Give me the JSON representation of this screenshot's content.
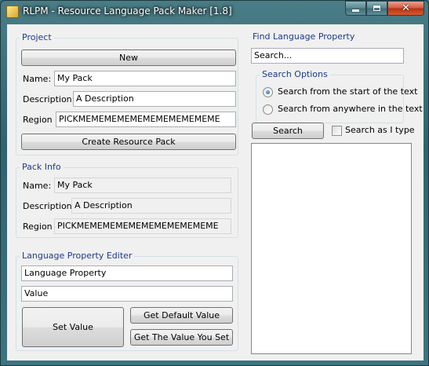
{
  "window": {
    "title": "RLPM - Resource Language Pack Maker [1.8]"
  },
  "project": {
    "title": "Project",
    "new_button": "New",
    "name_label": "Name:",
    "name_value": "My Pack",
    "description_label": "Description:",
    "description_value": "A Description",
    "region_label": "Region",
    "region_value": "PICKMEMEMEMEMEMEMEMEMEMEME",
    "create_button": "Create Resource Pack"
  },
  "pack_info": {
    "title": "Pack Info",
    "name_label": "Name:",
    "name_value": "My Pack",
    "description_label": "Description",
    "description_value": "A Description",
    "region_label": "Region",
    "region_value": "PICKMEMEMEMEMEMEMEMEMEMEME"
  },
  "editor": {
    "title": "Language Property Editer",
    "property_value": "Language Property",
    "value_value": "Value",
    "set_button": "Set Value",
    "default_button": "Get Default Value",
    "custom_button": "Get The Value You Set"
  },
  "find": {
    "title": "Find Language Property",
    "search_value": "Search...",
    "options_title": "Search Options",
    "option_start": "Search from the start of the text",
    "option_anywhere": "Search from anywhere in the text",
    "selected_option": "start",
    "search_button": "Search",
    "search_as_type_label": "Search as I type",
    "search_as_type_checked": false,
    "results": []
  }
}
